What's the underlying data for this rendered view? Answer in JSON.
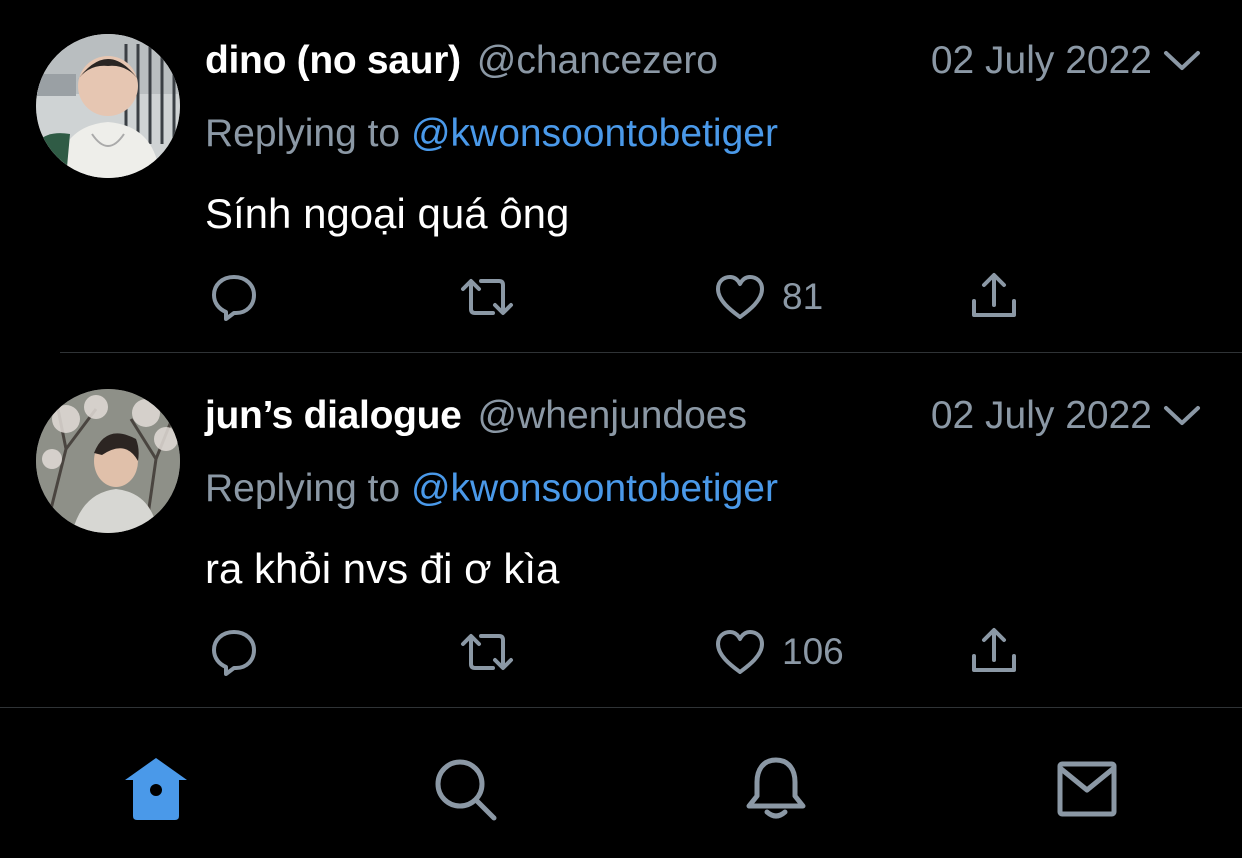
{
  "tweets": [
    {
      "display_name": "dino (no saur)",
      "handle": "@chancezero",
      "date": "02 July 2022",
      "replying_prefix": "Replying to ",
      "replying_to": "@kwonsoontobetiger",
      "text": "Sính ngoại quá ông",
      "like_count": "81"
    },
    {
      "display_name": "jun’s dialogue",
      "handle": "@whenjundoes",
      "date": "02 July 2022",
      "replying_prefix": "Replying to ",
      "replying_to": "@kwonsoontobetiger",
      "text": "ra khỏi nvs đi ơ kìa",
      "like_count": "106"
    }
  ],
  "colors": {
    "background": "#000000",
    "text_primary": "#ffffff",
    "text_secondary": "#8b98a5",
    "accent": "#4a99e9",
    "divider": "#2f3336"
  },
  "icons": {
    "reply": "reply-icon",
    "retweet": "retweet-icon",
    "like": "heart-icon",
    "share": "share-icon",
    "more": "chevron-down-icon",
    "tab_home": "home-icon",
    "tab_search": "search-icon",
    "tab_notifications": "bell-icon",
    "tab_messages": "mail-icon"
  }
}
